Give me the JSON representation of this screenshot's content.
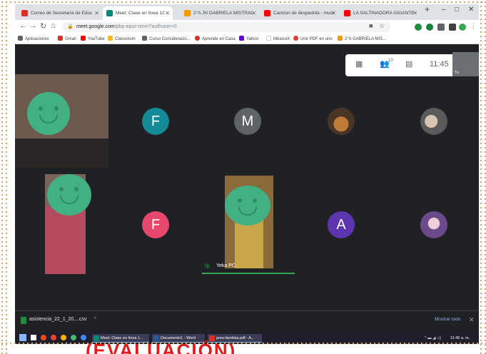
{
  "tabs": [
    {
      "title": "Correo de Secretaría de Educ",
      "fav": "#d93025"
    },
    {
      "title": "Meet: Clase en línea 12",
      "fav": "#00897b"
    },
    {
      "title": "2°A JN GABRIELA MISTRAL",
      "fav": "#f29900"
    },
    {
      "title": "Cancion de despedida - musi",
      "fav": "#ff0000"
    },
    {
      "title": "LA SALTINADORA GIGANTE",
      "fav": "#ff0000"
    }
  ],
  "window": {
    "new_tab": "+",
    "minimize": "–",
    "maximize": "□",
    "close": "✕"
  },
  "addressbar": {
    "host": "meet.google.com",
    "path": "/pbp-epur-nmm?authuser=0"
  },
  "bookmarks": [
    {
      "label": "Aplicaciones",
      "color": "#5f6368"
    },
    {
      "label": "Gmail",
      "color": "#d93025"
    },
    {
      "label": "YouTube",
      "color": "#ff0000"
    },
    {
      "label": "Classroom",
      "color": "#fbbc04"
    },
    {
      "label": "Curso Consideracio...",
      "color": "#5f6368"
    },
    {
      "label": "Aprende en Casa",
      "color": "#d93025"
    },
    {
      "label": "Yahoo",
      "color": "#6001d2"
    },
    {
      "label": "MéxicoX",
      "color": "#ffffff"
    },
    {
      "label": "Unir PDF en uno",
      "color": "#e53935"
    },
    {
      "label": "2°A GABRIELA MIS...",
      "color": "#f29900"
    }
  ],
  "meet": {
    "participants_count": "10",
    "time": "11:45",
    "self_label": "Tú",
    "tiles": [
      {
        "kind": "video"
      },
      {
        "kind": "initial",
        "letter": "F",
        "color": "#138a96"
      },
      {
        "kind": "initial",
        "letter": "M",
        "color": "#5f6368"
      },
      {
        "kind": "photo"
      },
      {
        "kind": "photo"
      },
      {
        "kind": "video"
      },
      {
        "kind": "initial",
        "letter": "F",
        "color": "#e8476c"
      },
      {
        "kind": "video",
        "name": "Yeka PC"
      },
      {
        "kind": "initial",
        "letter": "A",
        "color": "#5e35b1"
      },
      {
        "kind": "photo"
      }
    ]
  },
  "downloads": {
    "file": "asistencia_22_1_20....csv",
    "show_all": "Mostrar todo",
    "close": "✕",
    "chevron": "^"
  },
  "taskbar": {
    "apps": [
      {
        "label": "Meet: Clase en línea 1...",
        "color": "#00897b"
      },
      {
        "label": "Documento1 - Word",
        "color": "#2b579a"
      },
      {
        "label": "pree-familias.pdf - A...",
        "color": "#d93025"
      }
    ],
    "clock": "11:45 a. m."
  },
  "caption": "(EVALUACIÓN)"
}
